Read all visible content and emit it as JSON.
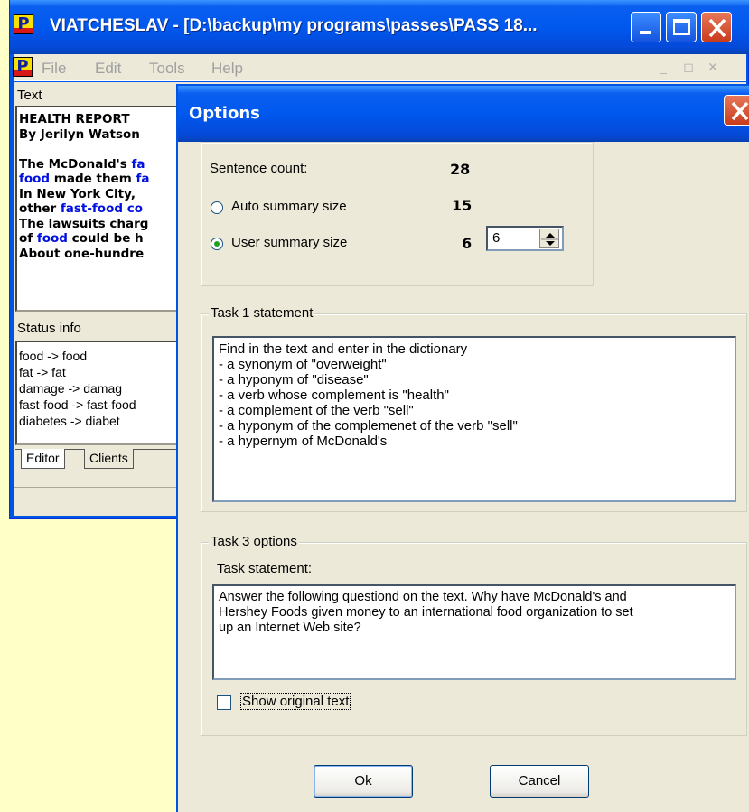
{
  "main_window": {
    "title": "VIATCHESLAV - [D:\\backup\\my programs\\passes\\PASS 18...",
    "icon_letter": "P",
    "menu": [
      "File",
      "Edit",
      "Tools",
      "Help"
    ],
    "text_label": "Text",
    "report_lines": [
      [
        {
          "t": "HEALTH REPORT",
          "c": "k"
        }
      ],
      [
        {
          "t": "By Jerilyn Watson",
          "c": "k"
        }
      ],
      [
        {
          "t": "",
          "c": "k"
        }
      ],
      [
        {
          "t": "The McDonald's ",
          "c": "k"
        },
        {
          "t": "fa",
          "c": "b"
        }
      ],
      [
        {
          "t": "food",
          "c": "b"
        },
        {
          "t": " made them ",
          "c": "k"
        },
        {
          "t": "fa",
          "c": "b"
        }
      ],
      [
        {
          "t": "In New York City,",
          "c": "k"
        }
      ],
      [
        {
          "t": "other ",
          "c": "k"
        },
        {
          "t": "fast-food co",
          "c": "b"
        }
      ],
      [
        {
          "t": "The lawsuits charg",
          "c": "k"
        }
      ],
      [
        {
          "t": "of ",
          "c": "k"
        },
        {
          "t": "food",
          "c": "b"
        },
        {
          "t": " could be h",
          "c": "k"
        }
      ],
      [
        {
          "t": "About one-hundre",
          "c": "k"
        }
      ]
    ],
    "status_label": "Status info",
    "status_lines": [
      "food -> food",
      "fat -> fat",
      "damage -> damag",
      "fast-food -> fast-food",
      "diabetes -> diabet"
    ],
    "tabs": [
      "Editor",
      "Clients"
    ]
  },
  "dialog": {
    "title": "Options",
    "sentence_count_label": "Sentence count:",
    "sentence_count": "28",
    "auto_label": "Auto summary size",
    "auto_value": "15",
    "user_label": "User summary size",
    "user_value": "6",
    "user_spin_value": "6",
    "selected_mode": "user",
    "task1_title": "Task 1 statement",
    "task1_lines": [
      "Find in the text and enter in the dictionary",
      "- a synonym of \"overweight\"",
      "- a hyponym of \"disease\"",
      "- a verb whose complement is \"health\"",
      "- a complement of the verb \"sell\"",
      "- a hyponym of the complemenet of the verb \"sell\"",
      "- a hypernym of McDonald's"
    ],
    "task3_title": "Task 3 options",
    "task_statement_label": "Task statement:",
    "task3_lines": [
      "Answer the following questiond on the text. Why have McDonald's and",
      "Hershey Foods  given money to an international food organization to set",
      "up an Internet Web site?"
    ],
    "show_original_label": "Show original text",
    "show_original_checked": false,
    "ok_label": "Ok",
    "cancel_label": "Cancel"
  }
}
